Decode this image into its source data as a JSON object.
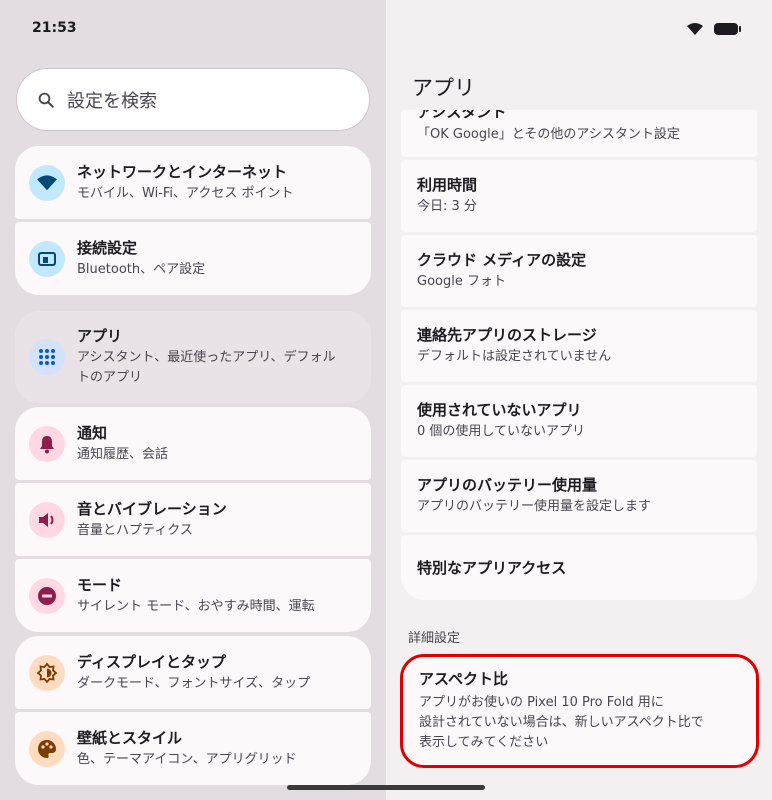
{
  "status": {
    "time": "21:53"
  },
  "search": {
    "placeholder": "設定を検索"
  },
  "left_items": [
    {
      "title": "ネットワークとインターネット",
      "subtitle": "モバイル、Wi-Fi、アクセス ポイント",
      "icon": "wifi-icon",
      "icon_bg": "#c2e8ff",
      "icon_color": "#004a77"
    },
    {
      "title": "接続設定",
      "subtitle": "Bluetooth、ペア設定",
      "icon": "connected-devices-icon",
      "icon_bg": "#c2e8ff",
      "icon_color": "#004a77"
    },
    {
      "title": "アプリ",
      "subtitle": "アシスタント、最近使ったアプリ、デフォルトのアプリ",
      "icon": "apps-grid-icon",
      "icon_bg": "#d3e3fd",
      "icon_color": "#0b57d0"
    },
    {
      "title": "通知",
      "subtitle": "通知履歴、会話",
      "icon": "bell-icon",
      "icon_bg": "#ffd8e4",
      "icon_color": "#8b1e4a"
    },
    {
      "title": "音とバイブレーション",
      "subtitle": "音量とハプティクス",
      "icon": "volume-icon",
      "icon_bg": "#ffd8e4",
      "icon_color": "#8b1e4a"
    },
    {
      "title": "モード",
      "subtitle": "サイレント モード、おやすみ時間、運転",
      "icon": "dnd-icon",
      "icon_bg": "#ffd8e4",
      "icon_color": "#8b1e4a"
    },
    {
      "title": "ディスプレイとタップ",
      "subtitle": "ダークモード、フォントサイズ、タップ",
      "icon": "brightness-icon",
      "icon_bg": "#ffdcc1",
      "icon_color": "#7a3e00"
    },
    {
      "title": "壁紙とスタイル",
      "subtitle": "色、テーマアイコン、アプリグリッド",
      "icon": "palette-icon",
      "icon_bg": "#ffdcc1",
      "icon_color": "#7a3e00"
    }
  ],
  "panel": {
    "title": "アプリ",
    "items": [
      {
        "title": "アシスタント",
        "subtitle": "「OK Google」とその他のアシスタント設定"
      },
      {
        "title": "利用時間",
        "subtitle": "今日: 3 分"
      },
      {
        "title": "クラウド メディアの設定",
        "subtitle": "Google フォト"
      },
      {
        "title": "連絡先アプリのストレージ",
        "subtitle": "デフォルトは設定されていません"
      },
      {
        "title": "使用されていないアプリ",
        "subtitle": "0 個の使用していないアプリ"
      },
      {
        "title": "アプリのバッテリー使用量",
        "subtitle": "アプリのバッテリー使用量を設定します"
      },
      {
        "title": "特別なアプリアクセス",
        "subtitle": ""
      }
    ],
    "section_label": "詳細設定",
    "aspect": {
      "title": "アスペクト比",
      "line1": "アプリがお使いの Pixel 10 Pro Fold 用に",
      "line2": "設計されていない場合は、新しいアスペクト比で",
      "line3": "表示してみてください",
      "highlight_color": "#e00000"
    }
  }
}
